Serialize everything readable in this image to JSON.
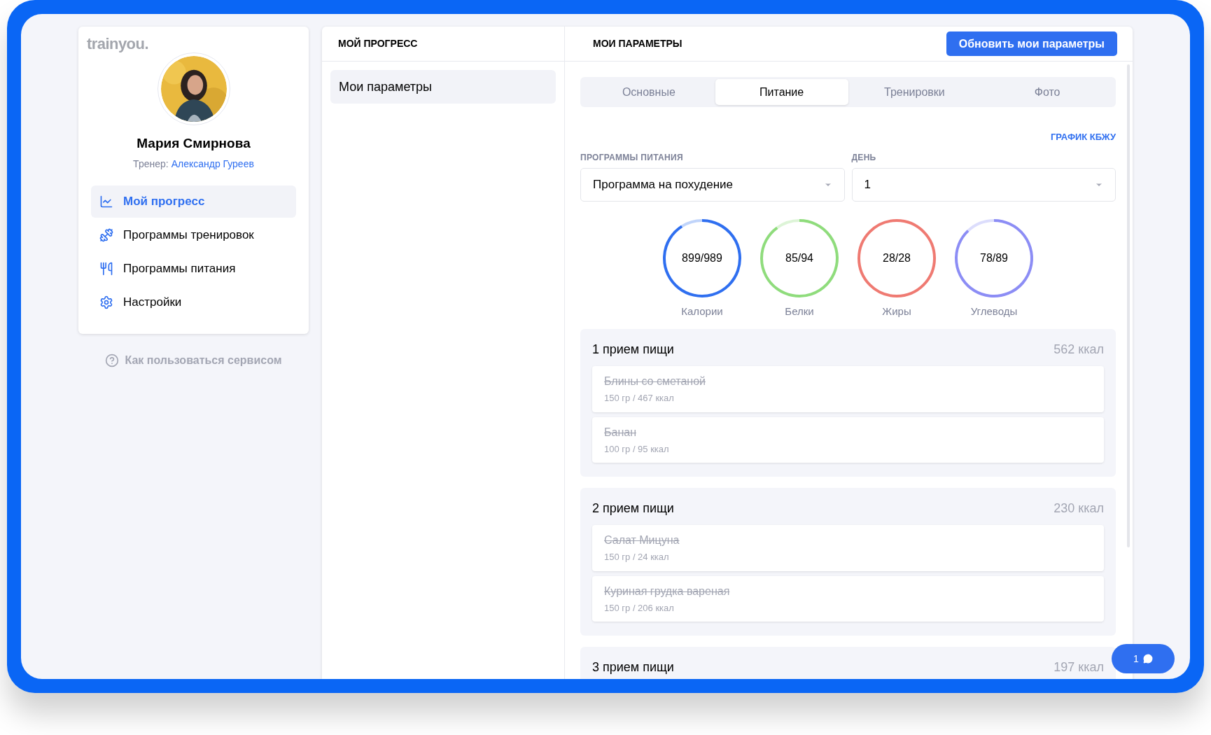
{
  "sidebar": {
    "logo": "trainyou.",
    "user_name": "Мария Смирнова",
    "trainer_label": "Тренер:",
    "trainer_name": "Александр Гуреев",
    "nav": [
      {
        "label": "Мой прогресс",
        "selected": true
      },
      {
        "label": "Программы тренировок",
        "selected": false
      },
      {
        "label": "Программы питания",
        "selected": false
      },
      {
        "label": "Настройки",
        "selected": false
      }
    ],
    "help": "Как пользоваться сервисом"
  },
  "progress": {
    "title": "МОЙ ПРОГРЕСС",
    "items": [
      {
        "label": "Мои параметры",
        "selected": true
      }
    ]
  },
  "params": {
    "title": "МОИ ПАРАМЕТРЫ",
    "update_button": "Обновить мои параметры",
    "tabs": [
      {
        "label": "Основные",
        "selected": false
      },
      {
        "label": "Питание",
        "selected": true
      },
      {
        "label": "Тренировки",
        "selected": false
      },
      {
        "label": "Фото",
        "selected": false
      }
    ],
    "chart_link": "ГРАФИК КБЖУ",
    "program": {
      "label": "ПРОГРАММЫ ПИТАНИЯ",
      "value": "Программа на похудение"
    },
    "day": {
      "label": "ДЕНЬ",
      "value": "1"
    },
    "macros": [
      {
        "value": "899/989",
        "label": "Калории",
        "level": 0.91,
        "color": "#2f6ff0"
      },
      {
        "value": "85/94",
        "label": "Белки",
        "level": 0.9,
        "color": "#8fdc7c"
      },
      {
        "value": "28/28",
        "label": "Жиры",
        "level": 1,
        "color": "#ef7a72"
      },
      {
        "value": "78/89",
        "label": "Углеводы",
        "level": 0.88,
        "color": "#8c8df5"
      }
    ],
    "meals": [
      {
        "title": "1 прием пищи",
        "kcal": "562 ккал",
        "foods": [
          {
            "name": "Блины со сметаной",
            "detail": "150 гр / 467 ккал",
            "eaten": true
          },
          {
            "name": "Банан",
            "detail": "100 гр / 95 ккал",
            "eaten": true
          }
        ]
      },
      {
        "title": "2 прием пищи",
        "kcal": "230 ккал",
        "foods": [
          {
            "name": "Салат Мицуна",
            "detail": "150 гр / 24 ккал",
            "eaten": true
          },
          {
            "name": "Куриная грудка вареная",
            "detail": "150 гр / 206 ккал",
            "eaten": true
          }
        ]
      },
      {
        "title": "3 прием пищи",
        "kcal": "197 ккал"
      }
    ]
  },
  "chat_button": {
    "count": "1"
  }
}
